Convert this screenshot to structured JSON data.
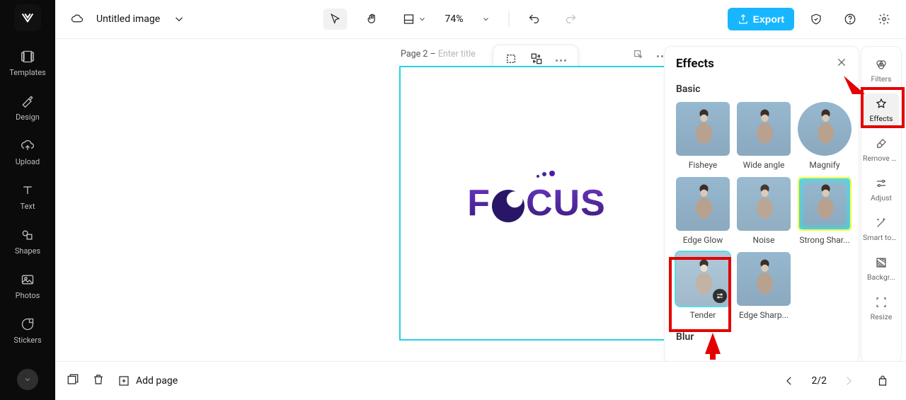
{
  "leftbar": {
    "items": [
      {
        "label": "Templates"
      },
      {
        "label": "Design"
      },
      {
        "label": "Upload"
      },
      {
        "label": "Text"
      },
      {
        "label": "Shapes"
      },
      {
        "label": "Photos"
      },
      {
        "label": "Stickers"
      }
    ]
  },
  "topbar": {
    "title": "Untitled image",
    "zoom": "74%",
    "export_label": "Export"
  },
  "page": {
    "number_label": "Page 2 –",
    "title_placeholder": "Enter title"
  },
  "canvas": {
    "logo_text_parts": [
      "F",
      "O",
      "C",
      "U",
      "S"
    ]
  },
  "effects": {
    "panel_title": "Effects",
    "sections": {
      "basic_title": "Basic",
      "blur_title": "Blur"
    },
    "items": [
      {
        "label": "Fisheye"
      },
      {
        "label": "Wide angle"
      },
      {
        "label": "Magnify"
      },
      {
        "label": "Edge Glow"
      },
      {
        "label": "Noise"
      },
      {
        "label": "Strong Shar..."
      },
      {
        "label": "Tender"
      },
      {
        "label": "Edge Sharp..."
      }
    ]
  },
  "rightrail": {
    "items": [
      {
        "label": "Filters"
      },
      {
        "label": "Effects"
      },
      {
        "label": "Remove backgr..."
      },
      {
        "label": "Adjust"
      },
      {
        "label": "Smart tools"
      },
      {
        "label": "Backgr..."
      },
      {
        "label": "Resize"
      }
    ]
  },
  "bottombar": {
    "add_page_label": "Add page",
    "page_counter": "2/2"
  },
  "colors": {
    "accent": "#17b6ff",
    "selection": "#26d2e3",
    "annotation": "#e30000"
  }
}
